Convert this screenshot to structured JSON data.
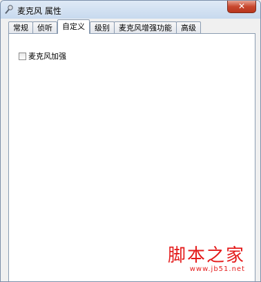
{
  "window": {
    "title": "麦克风 属性",
    "close_label": "✕"
  },
  "tabs": [
    {
      "label": "常规",
      "active": false
    },
    {
      "label": "侦听",
      "active": false
    },
    {
      "label": "自定义",
      "active": true
    },
    {
      "label": "级别",
      "active": false
    },
    {
      "label": "麦克风增强功能",
      "active": false
    },
    {
      "label": "高级",
      "active": false
    }
  ],
  "panel": {
    "checkbox_label": "麦克风加强",
    "checkbox_checked": false
  },
  "watermark": {
    "main": "脚本之家",
    "sub": "www.jb51.net"
  }
}
